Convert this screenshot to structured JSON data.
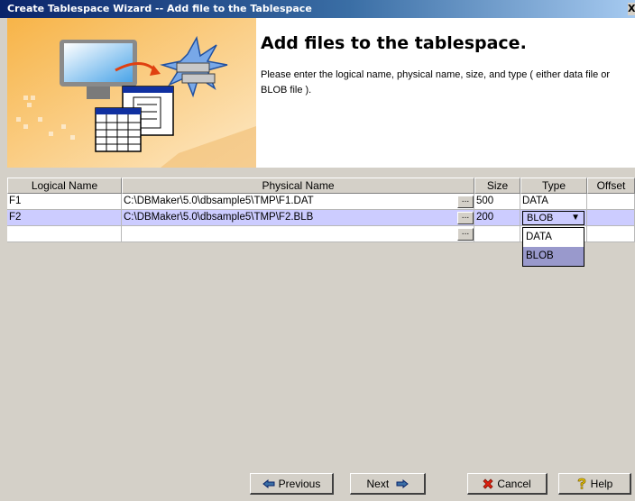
{
  "window": {
    "title": "Create Tablespace Wizard -- Add file to the Tablespace",
    "close_glyph": "X"
  },
  "banner": {
    "heading": "Add files to the tablespace.",
    "description": "Please enter the logical name, physical name, size, and type ( either data file or BLOB file )."
  },
  "table": {
    "columns": [
      "Logical Name",
      "Physical Name",
      "Size",
      "Type",
      "Offset"
    ],
    "rows": [
      {
        "logical": "F1",
        "physical": "C:\\DBMaker\\5.0\\dbsample5\\TMP\\F1.DAT",
        "browse": "...",
        "size": "500",
        "type": "DATA",
        "offset": ""
      },
      {
        "logical": "F2",
        "physical": "C:\\DBMaker\\5.0\\dbsample5\\TMP\\F2.BLB",
        "browse": "...",
        "size": "200",
        "type": "BLOB",
        "offset": ""
      },
      {
        "logical": "",
        "physical": "",
        "browse": "...",
        "size": "",
        "type": "",
        "offset": ""
      }
    ],
    "type_dropdown": {
      "selected": "BLOB",
      "options": [
        "DATA",
        "BLOB"
      ],
      "highlighted": "BLOB"
    }
  },
  "buttons": {
    "previous": "Previous",
    "next": "Next",
    "cancel": "Cancel",
    "help": "Help"
  },
  "icons": {
    "previous": "arrow-left-icon",
    "next": "arrow-right-icon",
    "cancel": "red-x-icon",
    "help": "question-mark-icon"
  },
  "colors": {
    "title_start": "#0a246a",
    "title_end": "#a6caf0",
    "selection": "#ccccff",
    "highlight_option": "#9999cc",
    "window_face": "#d4d0c8",
    "banner_art": "#f0a030"
  }
}
